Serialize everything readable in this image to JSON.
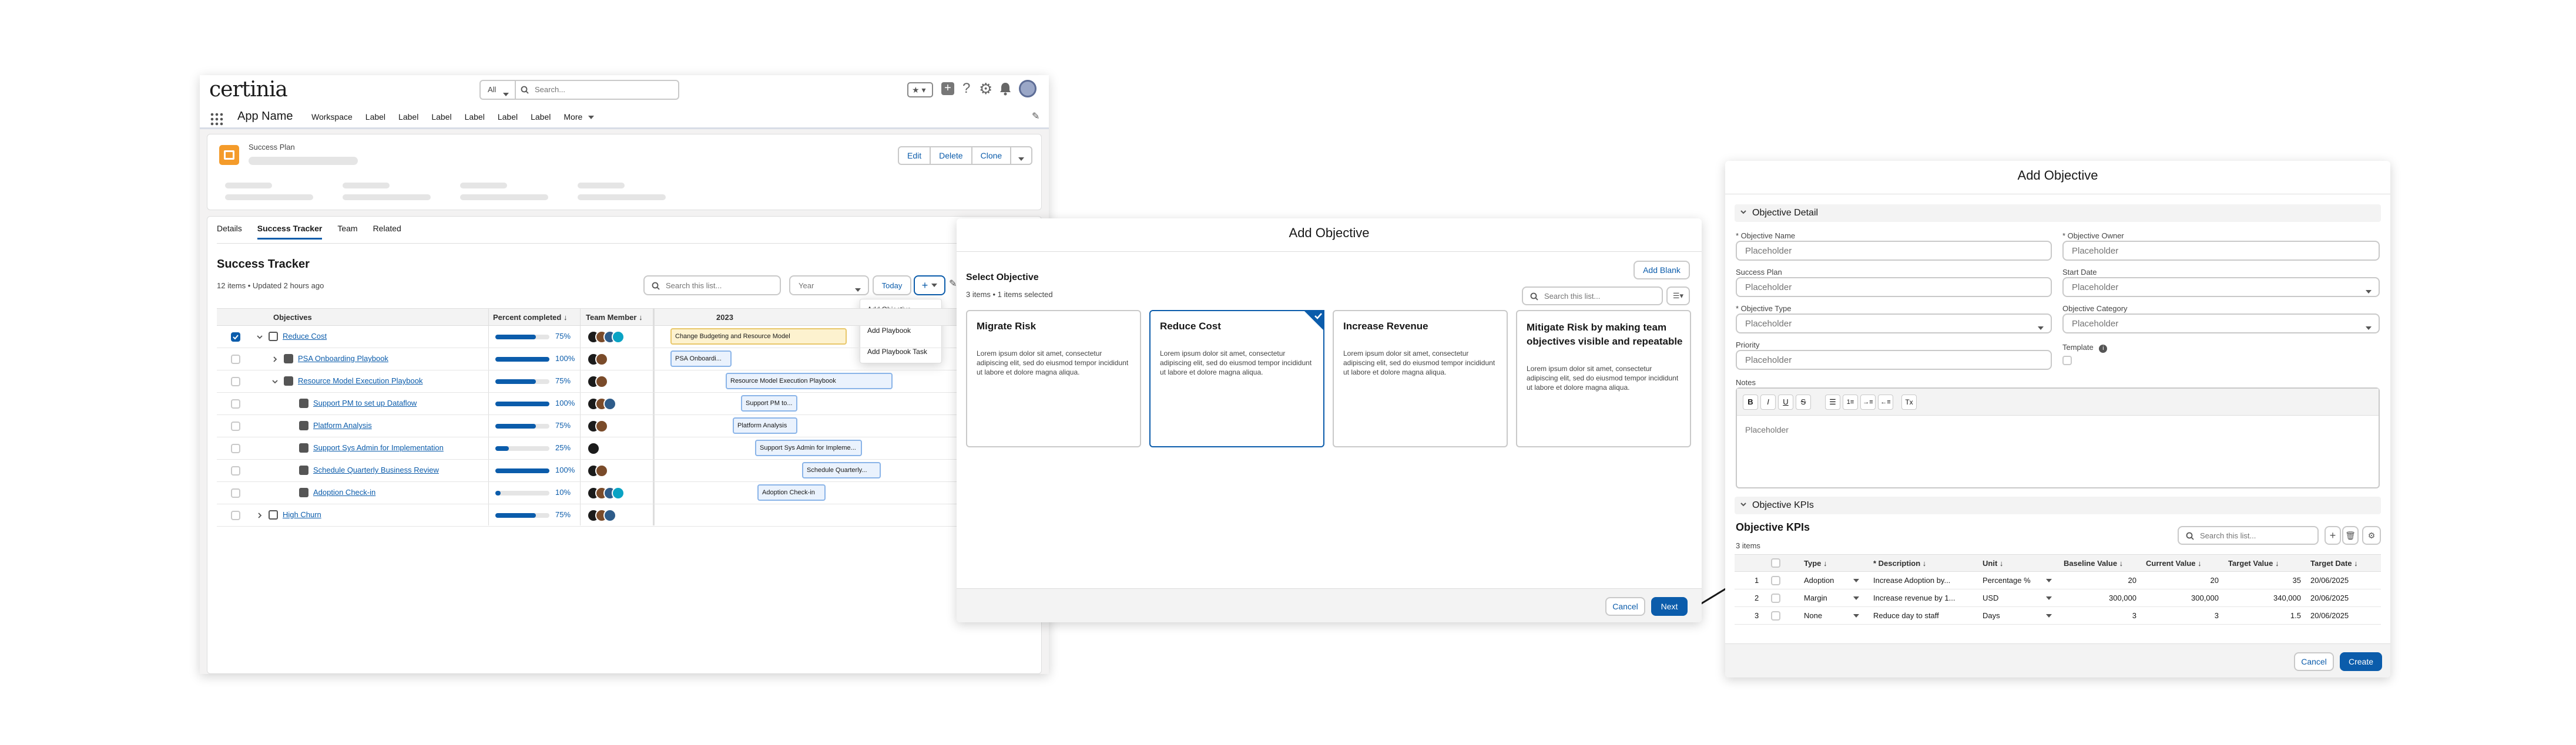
{
  "bg_app": {
    "logo": "certinia",
    "search": {
      "scope": "All",
      "placeholder": "Search..."
    },
    "app_name": "App Name",
    "nav_items": [
      "Workspace",
      "Label",
      "Label",
      "Label",
      "Label",
      "Label",
      "Label",
      "More"
    ],
    "record_type": "Success Plan",
    "actions": [
      "Edit",
      "Delete",
      "Clone"
    ],
    "tabs": [
      "Details",
      "Success Tracker",
      "Team",
      "Related"
    ],
    "active_tab": "Success Tracker",
    "tracker_title": "Success Tracker",
    "tracker_meta": "12 items • Updated 2 hours ago",
    "list_search_placeholder": "Search this list...",
    "period": "Year",
    "today_label": "Today",
    "columns": {
      "objectives": "Objectives",
      "percent": "Percent completed",
      "team": "Team Member",
      "year": "2023"
    },
    "add_menu": [
      "Add Objective",
      "Add Playbook",
      "Add Playbook Task"
    ],
    "rows": [
      {
        "name": "Reduce Cost",
        "pct": 75,
        "pct_label": "75%",
        "gantt": "Change Budgeting and Resource Model",
        "checked": true
      },
      {
        "name": "PSA Onboarding Playbook",
        "pct": 100,
        "pct_label": "100%",
        "gantt": "PSA Onboardi..."
      },
      {
        "name": "Resource Model Execution Playbook",
        "pct": 75,
        "pct_label": "75%",
        "gantt": "Resource Model Execution Playbook"
      },
      {
        "name": "Support PM to set up Dataflow",
        "pct": 100,
        "pct_label": "100%",
        "gantt": "Support PM to..."
      },
      {
        "name": "Platform Analysis",
        "pct": 75,
        "pct_label": "75%",
        "gantt": "Platform Analysis"
      },
      {
        "name": "Support Sys Admin for Implementation",
        "pct": 25,
        "pct_label": "25%",
        "gantt": "Support Sys Admin for Impleme..."
      },
      {
        "name": "Schedule Quarterly Business Review",
        "pct": 100,
        "pct_label": "100%",
        "gantt": "Schedule Quarterly..."
      },
      {
        "name": "Adoption Check-in",
        "pct": 10,
        "pct_label": "10%",
        "gantt": "Adoption Check-in"
      },
      {
        "name": "High Churn",
        "pct": 75,
        "pct_label": "75%",
        "gantt": ""
      }
    ]
  },
  "modal1": {
    "title": "Add Objective",
    "add_blank": "Add Blank",
    "select_heading": "Select Objective",
    "selection_meta": "3 items • 1 items selected",
    "search_placeholder": "Search this list...",
    "cards": [
      {
        "title": "Migrate Risk",
        "body": "Lorem ipsum dolor sit amet, consectetur adipiscing elit, sed do eiusmod tempor incididunt ut labore et dolore magna aliqua."
      },
      {
        "title": "Reduce Cost",
        "body": "Lorem ipsum dolor sit amet, consectetur adipiscing elit, sed do eiusmod tempor incididunt ut labore et dolore magna aliqua."
      },
      {
        "title": "Increase Revenue",
        "body": "Lorem ipsum dolor sit amet, consectetur adipiscing elit, sed do eiusmod tempor incididunt ut labore et dolore magna aliqua."
      },
      {
        "title": "Mitigate Risk by making team objectives visible and repeatable",
        "body": "Lorem ipsum dolor sit amet, consectetur adipiscing elit, sed do eiusmod tempor incididunt ut labore et dolore magna aliqua."
      }
    ],
    "cancel": "Cancel",
    "next": "Next"
  },
  "modal2": {
    "title": "Add Objective",
    "section_detail": "Objective Detail",
    "fields": {
      "objective_name": {
        "label": "* Objective Name",
        "placeholder": "Placeholder"
      },
      "objective_owner": {
        "label": "* Objective Owner",
        "placeholder": "Placeholder"
      },
      "success_plan": {
        "label": "Success Plan",
        "placeholder": "Placeholder"
      },
      "start_date": {
        "label": "Start Date",
        "placeholder": "Placeholder"
      },
      "objective_type": {
        "label": "* Objective Type",
        "placeholder": "Placeholder"
      },
      "objective_category": {
        "label": "Objective Category",
        "placeholder": "Placeholder"
      },
      "priority": {
        "label": "Priority",
        "placeholder": "Placeholder"
      },
      "template": {
        "label": "Template"
      },
      "notes": {
        "label": "Notes",
        "placeholder": "Placeholder"
      }
    },
    "section_kpis": "Objective KPIs",
    "kpis_title": "Objective KPIs",
    "kpis_meta": "3 items",
    "kpis_search_placeholder": "Search this list...",
    "kpi_columns": [
      "Type",
      "* Description",
      "Unit",
      "Baseline Value",
      "Current Value",
      "Target Value",
      "Target Date"
    ],
    "kpi_rows": [
      {
        "n": "1",
        "type": "Adoption",
        "desc": "Increase Adoption by...",
        "unit": "Percentage %",
        "baseline": "20",
        "current": "20",
        "target": "35",
        "date": "20/06/2025"
      },
      {
        "n": "2",
        "type": "Margin",
        "desc": "Increase revenue by 1...",
        "unit": "USD",
        "baseline": "300,000",
        "current": "300,000",
        "target": "340,000",
        "date": "20/06/2025"
      },
      {
        "n": "3",
        "type": "None",
        "desc": "Reduce day to staff",
        "unit": "Days",
        "baseline": "3",
        "current": "3",
        "target": "1.5",
        "date": "20/06/2025"
      }
    ],
    "cancel": "Cancel",
    "create": "Create"
  },
  "colors": {
    "brand": "#0b5cab",
    "border": "#c9c9c9",
    "orange_icon": "#f49b2a",
    "gantt_fill": "#eaf2fd",
    "highlight_fill": "#fdf2cf"
  }
}
